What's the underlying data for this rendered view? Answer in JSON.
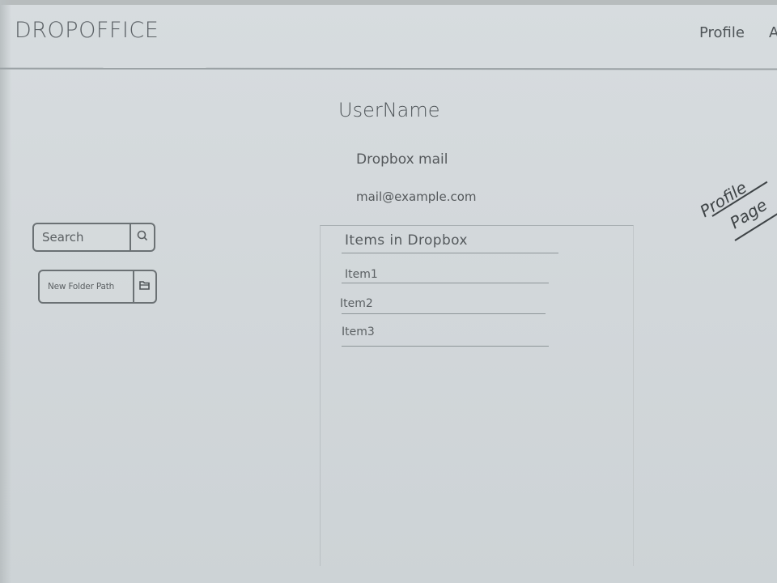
{
  "header": {
    "brand": "DROPOFFICE",
    "nav": {
      "profile_label": "Profile",
      "cut_label": "A"
    }
  },
  "user": {
    "name": "UserName",
    "mail_label": "Dropbox mail",
    "mail_value": "mail@example.com"
  },
  "annotation": {
    "line1": "Profile",
    "line2": "Page"
  },
  "sidebar": {
    "search_placeholder": "Search",
    "search_icon": "search-icon",
    "folder_placeholder": "New Folder Path",
    "folder_icon": "folder-icon"
  },
  "items_panel": {
    "title": "Items in Dropbox",
    "items": [
      "Item1",
      "Item2",
      "Item3"
    ]
  }
}
